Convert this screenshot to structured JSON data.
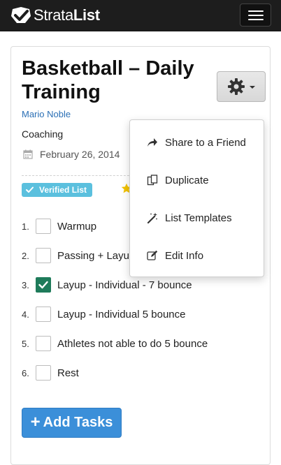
{
  "navbar": {
    "brand_part1": "Strata",
    "brand_part2": "List",
    "logo_icon": "check-badge-icon",
    "menu_icon": "hamburger-menu-icon"
  },
  "list": {
    "title": "Basketball – Daily Training",
    "author": "Mario Noble",
    "category": "Coaching",
    "date": "February 26, 2014",
    "verified_label": "Verified List",
    "gear_icon": "gear-icon"
  },
  "tasks": [
    {
      "num": "1.",
      "label": "Warmup",
      "checked": false
    },
    {
      "num": "2.",
      "label": "Passing + Layu",
      "checked": false
    },
    {
      "num": "3.",
      "label": "Layup - Individual - 7 bounce",
      "checked": true
    },
    {
      "num": "4.",
      "label": "Layup - Individual 5 bounce",
      "checked": false
    },
    {
      "num": "5.",
      "label": "Athletes not able to do 5 bounce",
      "checked": false
    },
    {
      "num": "6.",
      "label": "Rest",
      "checked": false
    }
  ],
  "add_button": {
    "label": "Add Tasks"
  },
  "dropdown": {
    "items": [
      {
        "label": "Share to a Friend",
        "icon": "share-arrow-icon"
      },
      {
        "label": "Duplicate",
        "icon": "duplicate-icon"
      },
      {
        "label": "List Templates",
        "icon": "magic-wand-icon"
      },
      {
        "label": "Edit Info",
        "icon": "edit-icon"
      }
    ]
  },
  "colors": {
    "navbar": "#1d1d1d",
    "link": "#2a6fb5",
    "verified": "#5bc0de",
    "checked": "#1e7b5a",
    "primary_button": "#3b8fd9",
    "star": "#f2c200"
  }
}
